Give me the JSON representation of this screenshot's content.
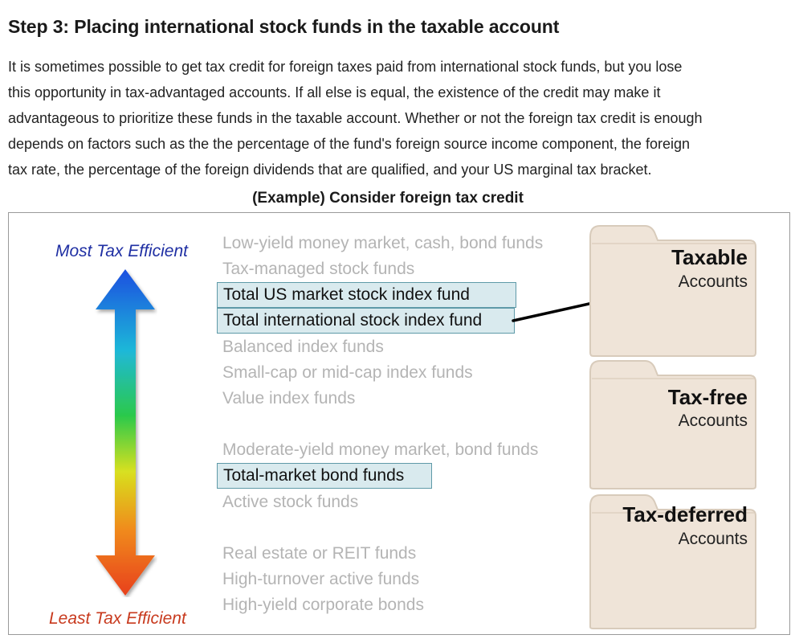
{
  "heading": "Step 3: Placing international stock funds in the taxable account",
  "paragraph_lines": [
    "It is sometimes possible to get tax credit for foreign taxes paid from international stock funds, but you lose",
    "this opportunity in tax-advantaged accounts. If all else is equal, the existence of the credit may make it",
    "advantageous to prioritize these funds in the taxable account. Whether or not the foreign tax credit is enough",
    "depends on factors such as the the percentage of the fund's foreign source income component, the foreign",
    "tax rate, the percentage of the foreign dividends that are qualified, and your US marginal tax bracket."
  ],
  "figure": {
    "caption": "(Example) Consider foreign tax credit",
    "most_label": "Most Tax Efficient",
    "least_label": "Least Tax Efficient",
    "funds": [
      {
        "label": "Low-yield money market, cash, bond funds",
        "highlighted": false
      },
      {
        "label": "Tax-managed stock funds",
        "highlighted": false
      },
      {
        "label": "Total US market stock index fund",
        "highlighted": true
      },
      {
        "label": "Total international stock index fund",
        "highlighted": true
      },
      {
        "label": "Balanced index funds",
        "highlighted": false
      },
      {
        "label": "Small-cap or mid-cap index funds",
        "highlighted": false
      },
      {
        "label": "Value index funds",
        "highlighted": false
      },
      {
        "label": "Moderate-yield money market, bond funds",
        "highlighted": false
      },
      {
        "label": "Total-market bond funds",
        "highlighted": true
      },
      {
        "label": "Active stock funds",
        "highlighted": false
      },
      {
        "label": "Real estate or REIT funds",
        "highlighted": false
      },
      {
        "label": "High-turnover active funds",
        "highlighted": false
      },
      {
        "label": "High-yield corporate bonds",
        "highlighted": false
      }
    ],
    "accounts": [
      {
        "title": "Taxable",
        "subtitle": "Accounts"
      },
      {
        "title": "Tax-free",
        "subtitle": "Accounts"
      },
      {
        "title": "Tax-deferred",
        "subtitle": "Accounts"
      }
    ],
    "colors": {
      "arrow_gradient": [
        "#1f4fe0",
        "#1fb8d8",
        "#2cc94a",
        "#d8e020",
        "#f08a1a",
        "#e8401a"
      ],
      "highlight_fill": "#d9eaee",
      "highlight_border": "#5f9aa8",
      "folder_fill": "#efe4d8",
      "folder_edge": "#d8cbbb",
      "most_label": "#1f2fa3",
      "least_label": "#c83a1e"
    },
    "pointer": {
      "from": "Total international stock index fund",
      "to": "Taxable"
    }
  }
}
